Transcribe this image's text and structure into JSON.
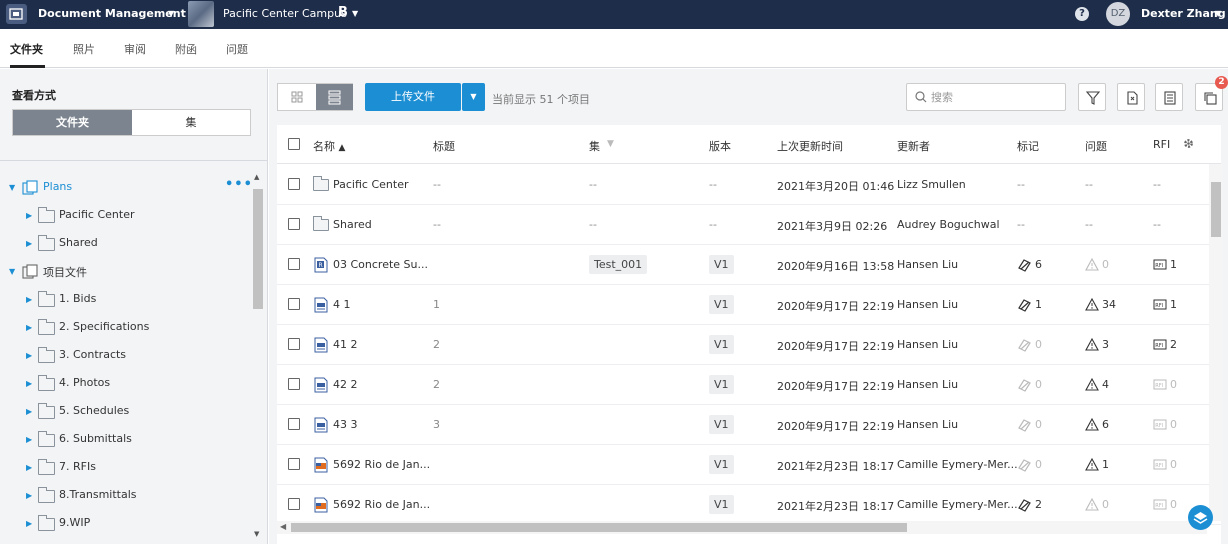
{
  "topbar": {
    "app_name": "Document Management",
    "project_name": "Pacific Center Campus",
    "project_badge": "B",
    "help": "?",
    "user_initials": "DZ",
    "user_name": "Dexter Zhang"
  },
  "tabs": [
    "文件夹",
    "照片",
    "审阅",
    "附函",
    "问题"
  ],
  "sidebar": {
    "view_label": "查看方式",
    "view_options": [
      "文件夹",
      "集"
    ],
    "tree": [
      {
        "label": "Plans",
        "level": 0,
        "root": true,
        "expanded": true
      },
      {
        "label": "Pacific Center",
        "level": 1
      },
      {
        "label": "Shared",
        "level": 1
      },
      {
        "label": "项目文件",
        "level": 0,
        "root": true,
        "expanded": true
      },
      {
        "label": "1. Bids",
        "level": 1
      },
      {
        "label": "2. Specifications",
        "level": 1
      },
      {
        "label": "3. Contracts",
        "level": 1
      },
      {
        "label": "4. Photos",
        "level": 1
      },
      {
        "label": "5. Schedules",
        "level": 1
      },
      {
        "label": "6. Submittals",
        "level": 1
      },
      {
        "label": "7. RFIs",
        "level": 1
      },
      {
        "label": "8.Transmittals",
        "level": 1
      },
      {
        "label": "9.WIP",
        "level": 1
      }
    ]
  },
  "toolbar": {
    "upload_label": "上传文件",
    "count_text": "当前显示 51 个项目",
    "search_placeholder": "搜索",
    "badge_count": "2"
  },
  "table": {
    "columns": [
      "名称",
      "标题",
      "集",
      "版本",
      "上次更新时间",
      "更新者",
      "标记",
      "问题",
      "RFI"
    ],
    "rows": [
      {
        "type": "folder",
        "name": "Pacific Center",
        "title": "--",
        "set": "--",
        "version": "--",
        "updated": "2021年3月20日 01:46",
        "updater": "Lizz Smullen",
        "markup": "--",
        "issues": "--",
        "rfi": "--"
      },
      {
        "type": "folder",
        "name": "Shared",
        "title": "--",
        "set": "--",
        "version": "--",
        "updated": "2021年3月9日 02:26",
        "updater": "Audrey Boguchwal",
        "markup": "--",
        "issues": "--",
        "rfi": "--"
      },
      {
        "type": "rvt",
        "name": "03 Concrete Su...",
        "title": "",
        "set": "Test_001",
        "version": "V1",
        "updated": "2020年9月16日 13:58",
        "updater": "Hansen Liu",
        "markup": "6",
        "issues": "0",
        "rfi": "1"
      },
      {
        "type": "pdf",
        "name": "4 1",
        "title": "1",
        "set": "",
        "version": "V1",
        "updated": "2020年9月17日 22:19",
        "updater": "Hansen Liu",
        "markup": "1",
        "issues": "34",
        "rfi": "1"
      },
      {
        "type": "pdf",
        "name": "41 2",
        "title": "2",
        "set": "",
        "version": "V1",
        "updated": "2020年9月17日 22:19",
        "updater": "Hansen Liu",
        "markup": "0",
        "issues": "3",
        "rfi": "2"
      },
      {
        "type": "pdf",
        "name": "42 2",
        "title": "2",
        "set": "",
        "version": "V1",
        "updated": "2020年9月17日 22:19",
        "updater": "Hansen Liu",
        "markup": "0",
        "issues": "4",
        "rfi": "0"
      },
      {
        "type": "pdf",
        "name": "43 3",
        "title": "3",
        "set": "",
        "version": "V1",
        "updated": "2020年9月17日 22:19",
        "updater": "Hansen Liu",
        "markup": "0",
        "issues": "6",
        "rfi": "0"
      },
      {
        "type": "dwg",
        "name": "5692 Rio de Jan...",
        "title": "",
        "set": "",
        "version": "V1",
        "updated": "2021年2月23日 18:17",
        "updater": "Camille Eymery-Mer...",
        "markup": "0",
        "issues": "1",
        "rfi": "0"
      },
      {
        "type": "dwg",
        "name": "5692 Rio de Jan...",
        "title": "",
        "set": "",
        "version": "V1",
        "updated": "2021年2月23日 18:17",
        "updater": "Camille Eymery-Mer...",
        "markup": "2",
        "issues": "0",
        "rfi": "0"
      }
    ]
  },
  "colors": {
    "topbar": "#1e2e4a",
    "accent": "#1c8fd4",
    "active_segment": "#7c858f",
    "badge": "#e85a4f"
  }
}
